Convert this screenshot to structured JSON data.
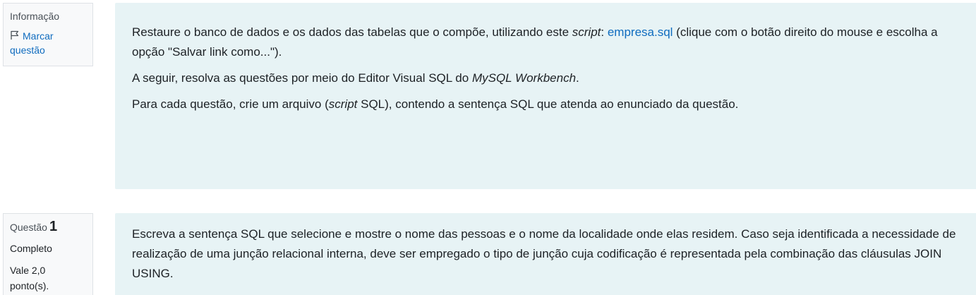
{
  "info": {
    "title": "Informação",
    "flag_label": "Marcar questão"
  },
  "intro": {
    "p1_a": "Restaure o banco de dados e os dados das tabelas que o compõe, utilizando este ",
    "p1_script": "script",
    "p1_b": ": ",
    "p1_link": "empresa.sql",
    "p1_c": " (clique com o botão direito do mouse e escolha a opção \"Salvar link como...\").",
    "p2_a": "A seguir, resolva as questões por meio do Editor Visual SQL do ",
    "p2_em": "MySQL Workbench",
    "p2_b": ".",
    "p3_a": "Para cada questão, crie um arquivo (",
    "p3_em": "script",
    "p3_b": " SQL), contendo a sentença SQL que atenda ao enunciado da questão."
  },
  "question": {
    "label": "Questão",
    "number": "1",
    "state": "Completo",
    "grade": "Vale 2,0 ponto(s).",
    "text": "Escreva a sentença SQL que selecione e mostre o nome das pessoas e o nome da localidade onde elas residem. Caso seja identificada a necessidade de realização de uma junção relacional interna, deve ser empregado o tipo de junção cuja codificação é representada pela combinação das cláusulas JOIN USING."
  }
}
